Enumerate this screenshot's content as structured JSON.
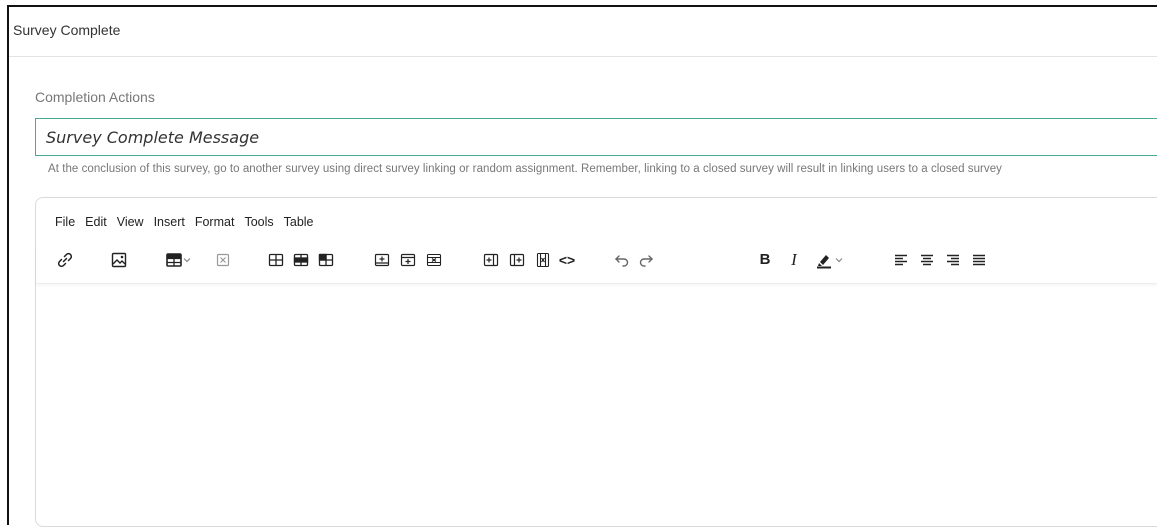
{
  "panel": {
    "title": "Survey Complete"
  },
  "completion": {
    "label": "Completion Actions",
    "message_value": "Survey Complete Message",
    "help_text": "At the conclusion of this survey, go to another survey using direct survey linking or random assignment. Remember, linking to a closed survey will result in linking users to a closed survey"
  },
  "editor": {
    "menu": [
      "File",
      "Edit",
      "View",
      "Insert",
      "Format",
      "Tools",
      "Table"
    ],
    "toolbar": {
      "bold_label": "B",
      "italic_label": "I",
      "source_code_label": "<>"
    },
    "colors": {
      "accent_border": "#4aa893",
      "icon": "#222222"
    },
    "icons": [
      "link-icon",
      "image-icon",
      "table-icon",
      "table-dropdown-icon",
      "delete-table-icon",
      "table-properties-icon",
      "row-properties-icon",
      "cell-properties-icon",
      "insert-row-before-icon",
      "insert-row-after-icon",
      "delete-row-icon",
      "insert-column-before-icon",
      "insert-column-after-icon",
      "delete-column-icon",
      "source-code-icon",
      "undo-icon",
      "redo-icon",
      "bold-icon",
      "italic-icon",
      "highlight-color-icon",
      "highlight-dropdown-icon",
      "align-left-icon",
      "align-center-icon",
      "align-right-icon",
      "justify-icon"
    ]
  }
}
